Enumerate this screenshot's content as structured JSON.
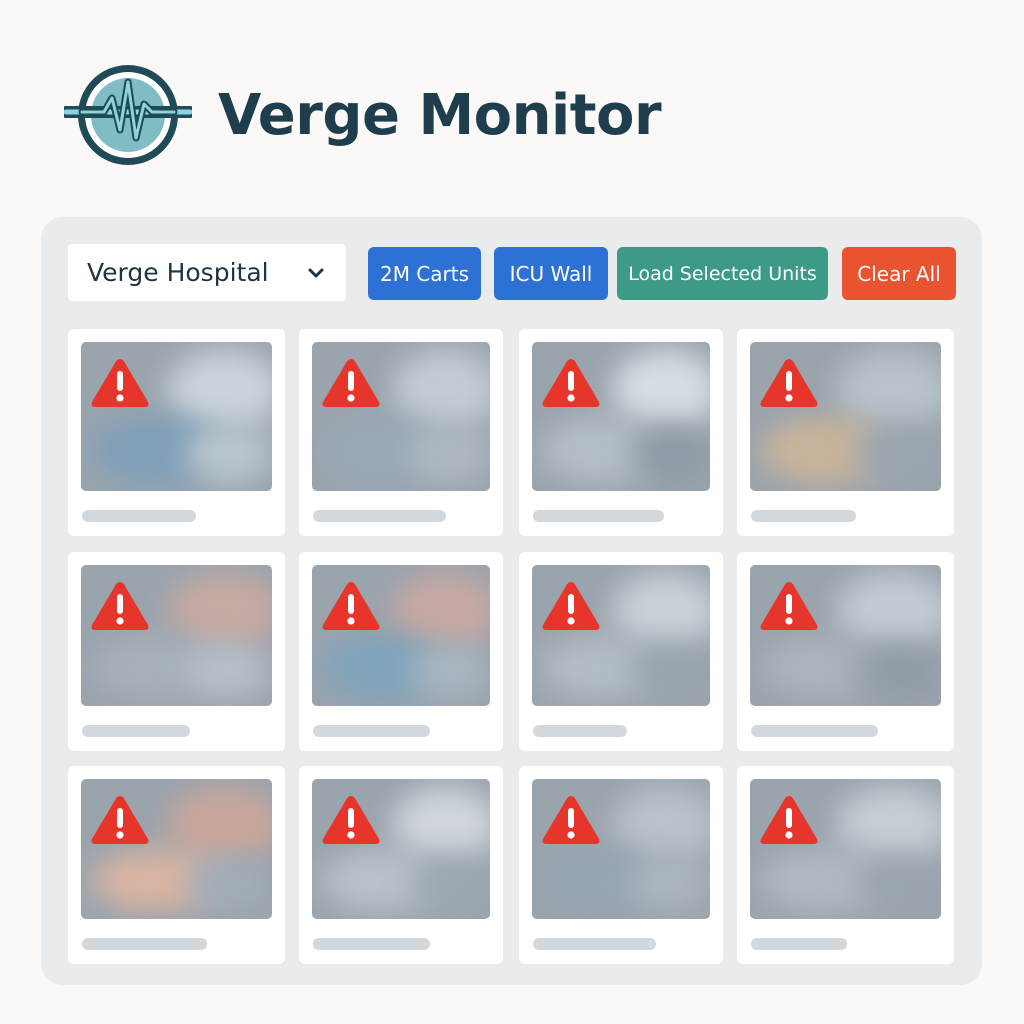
{
  "app": {
    "title": "Verge Monitor",
    "logo_icon": "heartbeat-logo-icon"
  },
  "toolbar": {
    "hospital_select": {
      "value": "Verge Hospital",
      "icon": "chevron-down-icon"
    },
    "buttons": [
      {
        "id": "2m-carts",
        "label": "2M Carts",
        "color": "#2c71d3"
      },
      {
        "id": "icu-wall",
        "label": "ICU Wall",
        "color": "#2c71d3"
      },
      {
        "id": "load-selected-units",
        "label": "Load Selected Units",
        "color": "#3c9a86"
      },
      {
        "id": "clear-all",
        "label": "Clear All",
        "color": "#e9532f"
      }
    ]
  },
  "grid": {
    "rows": 3,
    "columns": 4,
    "tiles": [
      {
        "status": "warning",
        "icon": "warning-triangle-icon"
      },
      {
        "status": "warning",
        "icon": "warning-triangle-icon"
      },
      {
        "status": "warning",
        "icon": "warning-triangle-icon"
      },
      {
        "status": "warning",
        "icon": "warning-triangle-icon"
      },
      {
        "status": "warning",
        "icon": "warning-triangle-icon"
      },
      {
        "status": "warning",
        "icon": "warning-triangle-icon"
      },
      {
        "status": "warning",
        "icon": "warning-triangle-icon"
      },
      {
        "status": "warning",
        "icon": "warning-triangle-icon"
      },
      {
        "status": "warning",
        "icon": "warning-triangle-icon"
      },
      {
        "status": "warning",
        "icon": "warning-triangle-icon"
      },
      {
        "status": "warning",
        "icon": "warning-triangle-icon"
      },
      {
        "status": "warning",
        "icon": "warning-triangle-icon"
      }
    ]
  },
  "colors": {
    "title": "#1f3e4d",
    "panel": "#e9ebed",
    "warning": "#e8352b",
    "logo_ring": "#1f4a57",
    "logo_fill": "#7fbcc4"
  }
}
